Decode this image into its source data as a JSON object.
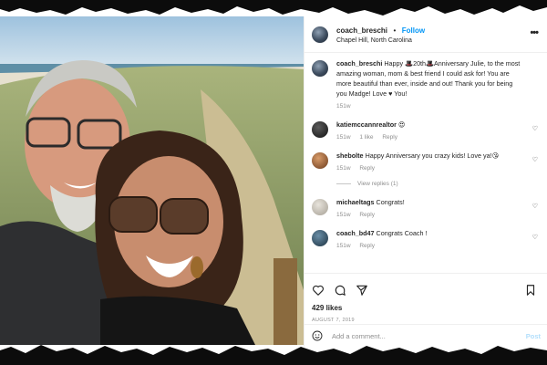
{
  "post": {
    "username": "coach_breschi",
    "follow_label": "Follow",
    "location": "Chapel Hill, North Carolina",
    "more_label": "•••",
    "caption": {
      "username": "coach_breschi",
      "text": "Happy 🎩20th🎩Anniversary Julie, to the most amazing woman, mom & best friend I could ask for! You are more beautiful than ever, inside and out! Thank you for being you Madge! Love ♥ You!",
      "time": "151w"
    },
    "comments": [
      {
        "username": "katiemccannrealtor",
        "text": "😍",
        "time": "151w",
        "likes": "1 like",
        "reply": "Reply"
      },
      {
        "username": "shebolte",
        "text": "Happy Anniversary you crazy kids! Love ya!😘",
        "time": "151w",
        "reply": "Reply",
        "view_replies": "View replies (1)"
      },
      {
        "username": "michaeltags",
        "text": "Congrats!",
        "time": "151w",
        "reply": "Reply"
      },
      {
        "username": "coach_bd47",
        "text": "Congrats Coach !",
        "time": "151w",
        "reply": "Reply"
      }
    ],
    "likes": "429 likes",
    "date": "AUGUST 7, 2019",
    "add_comment_placeholder": "Add a comment...",
    "post_label": "Post"
  },
  "icons": {
    "like": "heart-icon",
    "comment": "comment-icon",
    "share": "share-icon",
    "save": "bookmark-icon",
    "emoji": "smiley-icon",
    "more": "more-icon"
  },
  "colors": {
    "follow_blue": "#0095f6",
    "post_disabled": "#b2dffc",
    "muted": "#8e8e8e"
  }
}
